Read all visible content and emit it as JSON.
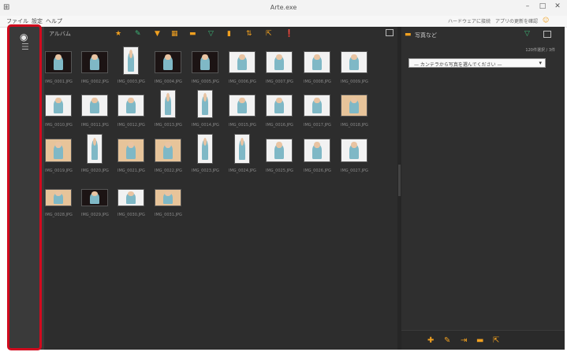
{
  "window": {
    "title": "Arte.exe"
  },
  "menu": [
    "ファイル",
    "設定",
    "ヘルプ"
  ],
  "menu_right": [
    "ハードウェアに接続",
    "アプリの更新を確認"
  ],
  "main": {
    "label": "アルバム",
    "toolbar_icons": [
      "star-icon",
      "tag-icon",
      "filter-icon",
      "grid-icon",
      "folder-icon",
      "filter-icon",
      "flag-icon",
      "sort-icon",
      "export-icon",
      "info-icon"
    ]
  },
  "thumbnails": [
    {
      "caption": "IMG_0001.JPG"
    },
    {
      "caption": "IMG_0002.JPG"
    },
    {
      "caption": "IMG_0003.JPG"
    },
    {
      "caption": "IMG_0004.JPG"
    },
    {
      "caption": "IMG_0005.JPG"
    },
    {
      "caption": "IMG_0006.JPG"
    },
    {
      "caption": "IMG_0007.JPG"
    },
    {
      "caption": "IMG_0008.JPG"
    },
    {
      "caption": "IMG_0009.JPG"
    },
    {
      "caption": "IMG_0010.JPG"
    },
    {
      "caption": "IMG_0011.JPG"
    },
    {
      "caption": "IMG_0012.JPG"
    },
    {
      "caption": "IMG_0013.JPG"
    },
    {
      "caption": "IMG_0014.JPG"
    },
    {
      "caption": "IMG_0015.JPG"
    },
    {
      "caption": "IMG_0016.JPG"
    },
    {
      "caption": "IMG_0017.JPG"
    },
    {
      "caption": "IMG_0018.JPG"
    },
    {
      "caption": "IMG_0019.JPG"
    },
    {
      "caption": "IMG_0020.JPG"
    },
    {
      "caption": "IMG_0021.JPG"
    },
    {
      "caption": "IMG_0022.JPG"
    },
    {
      "caption": "IMG_0023.JPG"
    },
    {
      "caption": "IMG_0024.JPG"
    },
    {
      "caption": "IMG_0025.JPG"
    },
    {
      "caption": "IMG_0026.JPG"
    },
    {
      "caption": "IMG_0027.JPG"
    },
    {
      "caption": "IMG_0028.JPG"
    },
    {
      "caption": "IMG_0029.JPG"
    },
    {
      "caption": "IMG_0030.JPG"
    },
    {
      "caption": "IMG_0031.JPG"
    }
  ],
  "right_panel": {
    "title": "写真など",
    "count": "120件選択 / 3件",
    "select_value": "— カンテラから写真を選んでください —"
  },
  "colors": {
    "accent": "#f0a020",
    "highlight": "#d10a1e",
    "filter": "#3cb878",
    "bg": "#2d2d2d"
  }
}
